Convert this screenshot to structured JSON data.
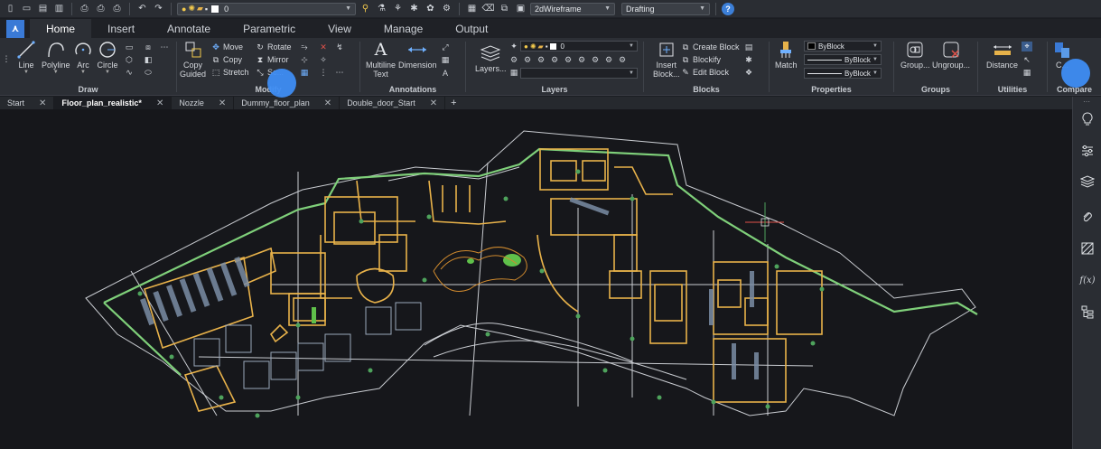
{
  "quick_access": {
    "layer_value": "0",
    "visual_style": "2dWireframe",
    "workspace": "Drafting",
    "help_label": "?"
  },
  "ribbon_tabs": [
    "Home",
    "Insert",
    "Annotate",
    "Parametric",
    "View",
    "Manage",
    "Output"
  ],
  "ribbon": {
    "draw": {
      "title": "Draw",
      "line": "Line",
      "polyline": "Polyline",
      "arc": "Arc",
      "circle": "Circle"
    },
    "modify": {
      "title": "Modify",
      "copy_guided_1": "Copy",
      "copy_guided_2": "Guided",
      "move": "Move",
      "copy": "Copy",
      "stretch": "Stretch",
      "rotate": "Rotate",
      "mirror": "Mirror",
      "scale": "Sc..."
    },
    "annotations": {
      "title": "Annotations",
      "multiline_1": "Multiline",
      "multiline_2": "Text",
      "dimension": "Dimension"
    },
    "layers": {
      "title": "Layers",
      "layers_btn": "Layers...",
      "layer_value": "0"
    },
    "blocks": {
      "title": "Blocks",
      "insert_1": "Insert",
      "insert_2": "Block...",
      "create_block": "Create Block",
      "blockify": "Blockify",
      "edit_block": "Edit Block"
    },
    "properties": {
      "title": "Properties",
      "match": "Match",
      "color": "ByBlock",
      "linetype": "ByBlock",
      "lineweight": "ByBlock"
    },
    "groups": {
      "title": "Groups",
      "group": "Group...",
      "ungroup": "Ungroup..."
    },
    "utilities": {
      "title": "Utilities",
      "distance": "Distance"
    },
    "compare": {
      "title": "Compare",
      "compare_label": "C..."
    }
  },
  "doc_tabs": [
    "Start",
    "Floor_plan_realistic*",
    "Nozzle",
    "Dummy_floor_plan",
    "Double_door_Start"
  ],
  "doc_tab_close": "✕",
  "doc_tab_add": "+",
  "right_panel_icons": [
    "lightbulb-icon",
    "sliders-icon",
    "layers-icon",
    "paperclip-icon",
    "hatch-icon",
    "function-icon",
    "hierarchy-icon"
  ],
  "function_label": "f(x)",
  "colors": {
    "accent": "#3a7ad6",
    "wall_yellow": "#e8b24a",
    "wall_green": "#7fd07a",
    "outline_white": "#c9ccd1",
    "cursor_red": "#e0524a"
  }
}
